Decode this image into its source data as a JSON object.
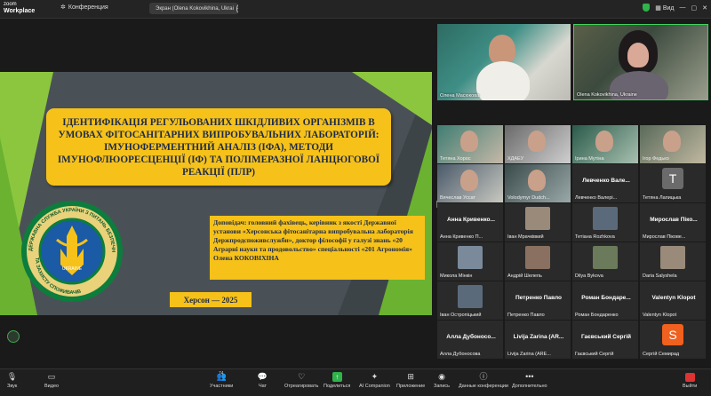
{
  "app": {
    "brand_line1": "zoom",
    "brand_line2": "Workplace",
    "meeting_label": "Конференция",
    "screen_share_label": "Экран (Olena Kokovikhina, Ukrai",
    "view_label": "Вид"
  },
  "slide": {
    "title": "ІДЕНТИФІКАЦІЯ РЕГУЛЬОВАНИХ ШКІДЛИВИХ ОРГАНІЗМІВ В УМОВАХ ФІТОСАНІТАРНИХ ВИПРОБУВАЛЬНИХ ЛАБОРАТОРІЙ: ІМУНОФЕРМЕНТНИЙ АНАЛІЗ (ІФА), МЕТОДИ ІМУНОФЛЮОРЕСЦЕНЦІЇ (ІФ) ТА ПОЛІМЕРАЗНОЇ ЛАНЦЮГОВОЇ РЕАКЦІЇ (ПЛР)",
    "speaker_info": "Доповідач: головний фахівець, керівник з якості Державної установи «Херсонська фітосанітарна випробувальна лабораторія Держпродспоживслужби», доктор філософії у галузі знань «20 Аграрні науки та продовольство» спеціальності «201 Агрономія» Олена КОКОВІХІНА",
    "city_year": "Херсон — 2025",
    "emblem_text_top": "ДЕРЖАВНА СЛУЖБА УКРАЇНИ З ПИТАНЬ БЕЗПЕЧНОСТІ ХАРЧОВИХ ПРОДУКТІВ",
    "emblem_text_bottom": "ТА ЗАХИСТУ СПОЖИВАЧІВ",
    "emblem_center": "UKRAINE"
  },
  "speakers": [
    {
      "name": "Олена Масюкова"
    },
    {
      "name": "Olena Kokovikhina, Ukraine"
    }
  ],
  "gallery": [
    {
      "big": "",
      "label": "Тетяна Хорос",
      "kind": "video"
    },
    {
      "big": "",
      "label": "ХДАЕУ",
      "kind": "video"
    },
    {
      "big": "",
      "label": "Ірина Мутіна",
      "kind": "video"
    },
    {
      "big": "",
      "label": "Ігор Федько",
      "kind": "video"
    },
    {
      "big": "",
      "label": "Вячеслав Уссат",
      "kind": "video"
    },
    {
      "big": "",
      "label": "Volodymyr Dudch...",
      "kind": "video"
    },
    {
      "big": "Левченко Вале...",
      "label": "Левченко Валерi...",
      "kind": "name"
    },
    {
      "big": "T",
      "label": "Тетяна Лапицька",
      "kind": "avatar"
    },
    {
      "big": "Анна Кривенко...",
      "label": "Анна Кривенко П...",
      "kind": "name"
    },
    {
      "big": "",
      "label": "Іван Мрачківкий",
      "kind": "photo"
    },
    {
      "big": "",
      "label": "Тетiана Rozhkova",
      "kind": "photo"
    },
    {
      "big": "Мирослав Пiко...",
      "label": "Мирослав Пiкове...",
      "kind": "name"
    },
    {
      "big": "",
      "label": "Микола Мiнкiн",
      "kind": "photo"
    },
    {
      "big": "",
      "label": "Андрiй Шелепь",
      "kind": "photo"
    },
    {
      "big": "",
      "label": "Dilya Bykova",
      "kind": "photo"
    },
    {
      "big": "",
      "label": "Daria Salyshela",
      "kind": "photo"
    },
    {
      "big": "",
      "label": "Iван Остропiцький",
      "kind": "photo"
    },
    {
      "big": "Петренко Павло",
      "label": "Петренко Павло",
      "kind": "name"
    },
    {
      "big": "Роман Бондаре...",
      "label": "Роман Бондаренко",
      "kind": "name"
    },
    {
      "big": "Valentyn Klopot",
      "label": "Valentyn Klopot",
      "kind": "name"
    },
    {
      "big": "Алла Дубоносо...",
      "label": "Алла Дубоносова",
      "kind": "name"
    },
    {
      "big": "Livija Zarina (AR...",
      "label": "Livija Zarina (ARE...",
      "kind": "name"
    },
    {
      "big": "Гаєвський Сергій",
      "label": "Гаєвський Сергій",
      "kind": "name"
    },
    {
      "big": "S",
      "label": "Сергій Семирад",
      "kind": "avatar-s"
    }
  ],
  "toolbar": {
    "audio": "Звук",
    "video": "Видео",
    "participants": "Участники",
    "participants_count": "74",
    "chat": "Чат",
    "react": "Отреагировать",
    "share": "Поделиться",
    "ai": "AI Companion",
    "apps": "Приложение",
    "record": "Запись",
    "meeting_data": "Данные конференции",
    "more": "Дополнительно",
    "leave": "Выйти"
  },
  "colors": {
    "slide_yellow": "#f6c21a",
    "slide_green": "#8cc63f",
    "share_green": "#2fb34a",
    "active_speaker_border": "#3fd35a",
    "avatar_t": "#6b6b6b",
    "avatar_s": "#f0601e"
  }
}
